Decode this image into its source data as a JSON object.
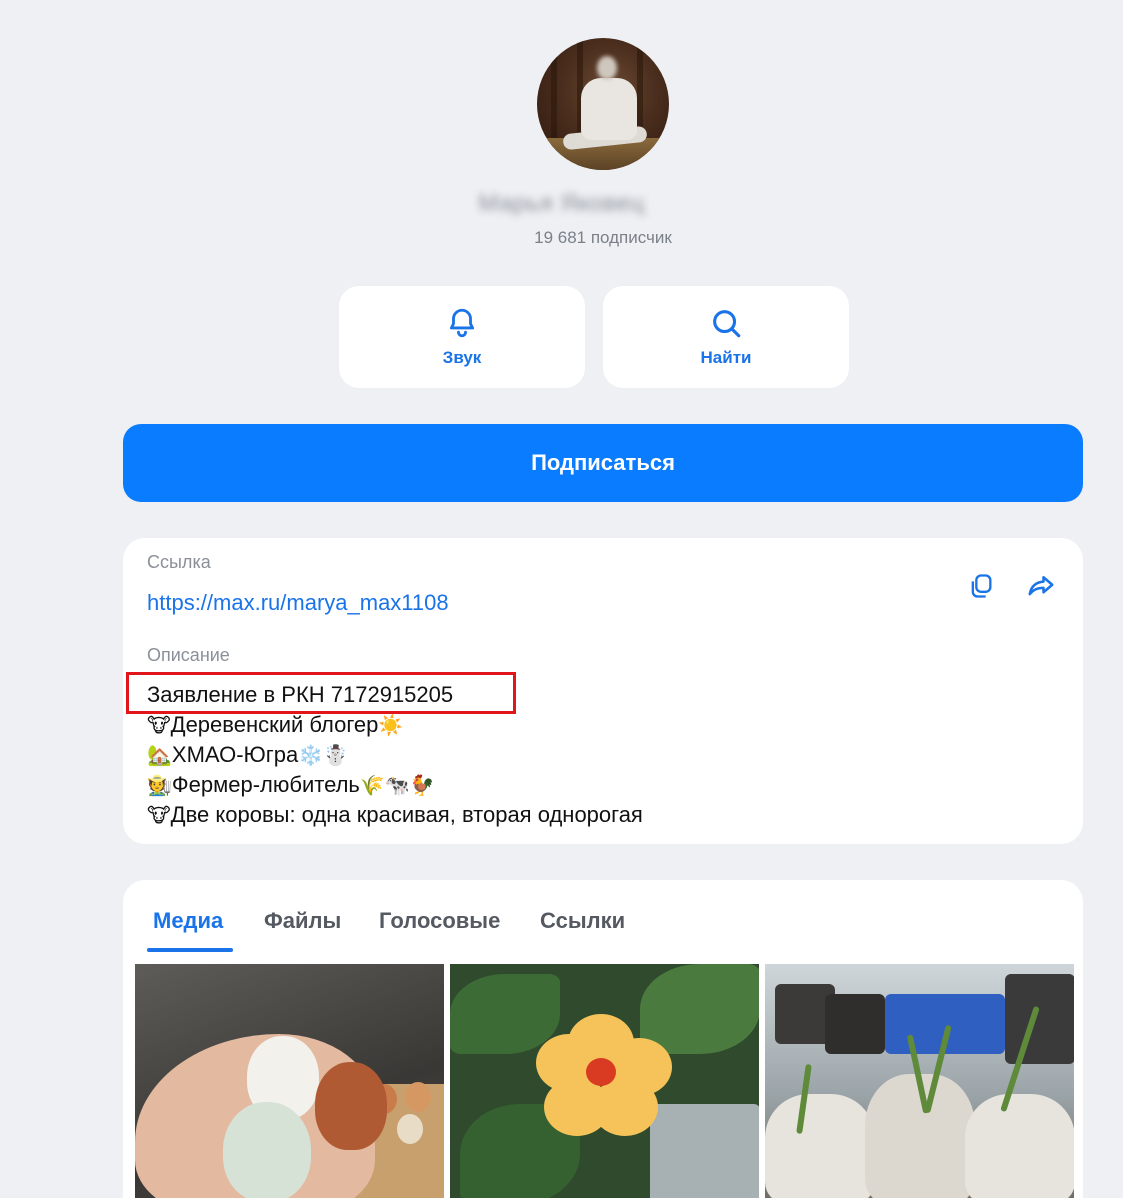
{
  "profile": {
    "name": "Марья Яковец",
    "subscribers": "19 681 подписчик"
  },
  "actions": {
    "sound_label": "Звук",
    "find_label": "Найти",
    "subscribe_label": "Подписаться"
  },
  "info": {
    "link_label": "Ссылка",
    "link_url": "https://max.ru/marya_max1108",
    "description_label": "Описание",
    "description_lines": [
      {
        "emoji": "",
        "text": "Заявление в РКН 7172915205",
        "emoji_after": ""
      },
      {
        "emoji": "🐮",
        "text": "Деревенский блогер",
        "emoji_after": "☀️"
      },
      {
        "emoji": "🏡",
        "text": "ХМАО-Югра",
        "emoji_after": "❄️☃️"
      },
      {
        "emoji": "🧑‍🌾",
        "text": "Фермер-любитель",
        "emoji_after": "🌾🐄🐓"
      },
      {
        "emoji": "🐮",
        "text": "Две коровы: одна красивая, вторая однорогая",
        "emoji_after": ""
      }
    ]
  },
  "tabs": {
    "items": [
      "Медиа",
      "Файлы",
      "Голосовые",
      "Ссылки"
    ],
    "active": "Медиа"
  },
  "icons": {
    "sound": "bell-icon",
    "find": "search-icon",
    "copy": "copy-icon",
    "share": "share-arrow-icon"
  },
  "colors": {
    "accent": "#0a7cff",
    "highlight": "#e0161b"
  }
}
